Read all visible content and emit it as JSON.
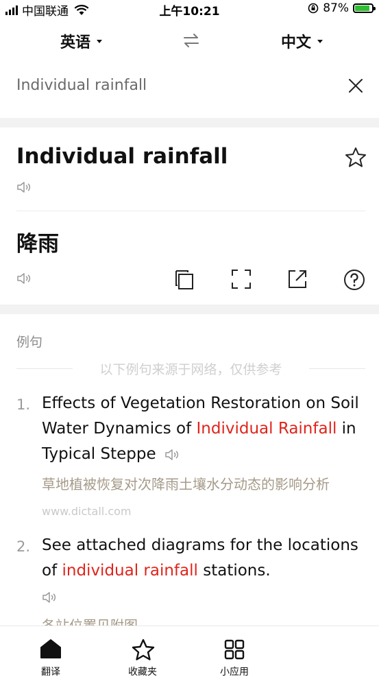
{
  "status_bar": {
    "carrier": "中国联通",
    "time": "上午10:21",
    "battery": "87%",
    "battery_level": 0.87,
    "battery_color": "#2ec02f"
  },
  "lang_bar": {
    "source_lang": "英语",
    "target_lang": "中文"
  },
  "input": {
    "value": "Individual rainfall"
  },
  "result": {
    "title": "Individual rainfall",
    "translation": "降雨"
  },
  "examples": {
    "heading": "例句",
    "note": "以下例句来源于网络，仅供参考",
    "items": [
      {
        "num": "1.",
        "en_pre": "Effects of Vegetation Restoration on Soil Water Dynamics of ",
        "en_hl": "Individual Rainfall",
        "en_post": " in Typical Steppe",
        "zh": "草地植被恢复对次降雨土壤水分动态的影响分析",
        "source": "www.dictall.com"
      },
      {
        "num": "2.",
        "en_pre": "See attached diagrams for the locations of ",
        "en_hl": "individual rainfall",
        "en_post": " stations.",
        "zh": "各站位置见附图"
      }
    ]
  },
  "tabbar": {
    "tabs": [
      {
        "label": "翻译",
        "icon": "home-icon"
      },
      {
        "label": "收藏夹",
        "icon": "star-icon"
      },
      {
        "label": "小应用",
        "icon": "apps-grid-icon"
      }
    ]
  },
  "colors": {
    "highlight": "#e0241b",
    "chinese_text": "#a59a89"
  }
}
